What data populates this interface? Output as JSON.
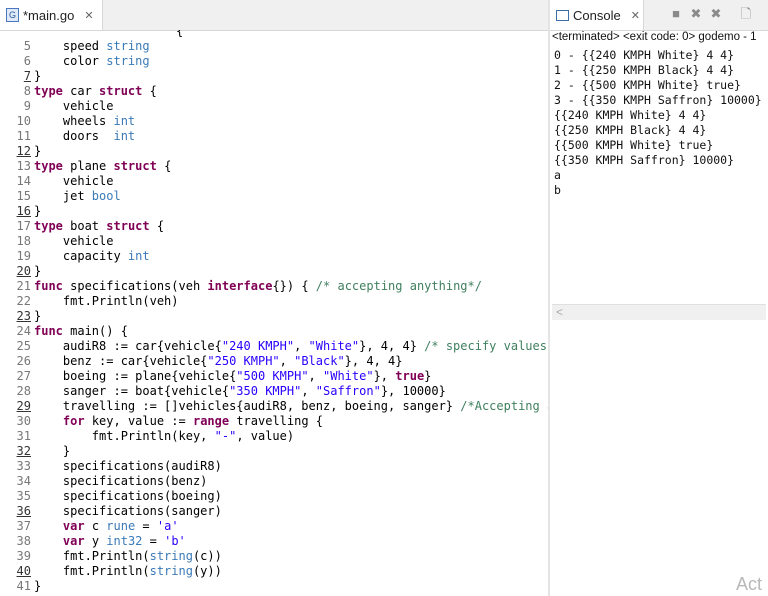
{
  "editor": {
    "tab": {
      "icon": "go-file-icon",
      "icon_glyph": "G",
      "title": "*main.go",
      "close": "✕"
    }
  },
  "code_lines": [
    {
      "n": "",
      "partial": true,
      "segs": [
        [
          "",
          "~"
        ]
      ]
    },
    {
      "n": "5",
      "segs": [
        [
          "",
          "    speed "
        ],
        [
          "ty",
          "string"
        ]
      ]
    },
    {
      "n": "6",
      "segs": [
        [
          "",
          "    color "
        ],
        [
          "ty",
          "string"
        ]
      ]
    },
    {
      "n": "7",
      "u": true,
      "segs": [
        [
          "",
          "}"
        ]
      ]
    },
    {
      "n": "8",
      "segs": [
        [
          "kw",
          "type"
        ],
        [
          "",
          " car "
        ],
        [
          "kw",
          "struct"
        ],
        [
          "",
          " {"
        ]
      ]
    },
    {
      "n": "9",
      "segs": [
        [
          "",
          "    vehicle"
        ]
      ]
    },
    {
      "n": "10",
      "segs": [
        [
          "",
          "    wheels "
        ],
        [
          "ty",
          "int"
        ]
      ]
    },
    {
      "n": "11",
      "segs": [
        [
          "",
          "    doors  "
        ],
        [
          "ty",
          "int"
        ]
      ]
    },
    {
      "n": "12",
      "u": true,
      "segs": [
        [
          "",
          "}"
        ]
      ]
    },
    {
      "n": "13",
      "segs": [
        [
          "kw",
          "type"
        ],
        [
          "",
          " plane "
        ],
        [
          "kw",
          "struct"
        ],
        [
          "",
          " {"
        ]
      ]
    },
    {
      "n": "14",
      "segs": [
        [
          "",
          "    vehicle"
        ]
      ]
    },
    {
      "n": "15",
      "segs": [
        [
          "",
          "    jet "
        ],
        [
          "ty",
          "bool"
        ]
      ]
    },
    {
      "n": "16",
      "u": true,
      "segs": [
        [
          "",
          "}"
        ]
      ]
    },
    {
      "n": "17",
      "segs": [
        [
          "kw",
          "type"
        ],
        [
          "",
          " boat "
        ],
        [
          "kw",
          "struct"
        ],
        [
          "",
          " {"
        ]
      ]
    },
    {
      "n": "18",
      "segs": [
        [
          "",
          "    vehicle"
        ]
      ]
    },
    {
      "n": "19",
      "segs": [
        [
          "",
          "    capacity "
        ],
        [
          "ty",
          "int"
        ]
      ]
    },
    {
      "n": "20",
      "u": true,
      "segs": [
        [
          "",
          "}"
        ]
      ]
    },
    {
      "n": "21",
      "segs": [
        [
          "kw",
          "func"
        ],
        [
          "",
          " specifications(veh "
        ],
        [
          "kw",
          "interface"
        ],
        [
          "",
          "{}) { "
        ],
        [
          "cm",
          "/* accepting anything*/"
        ]
      ]
    },
    {
      "n": "22",
      "segs": [
        [
          "",
          "    fmt.Println(veh)"
        ]
      ]
    },
    {
      "n": "23",
      "u": true,
      "segs": [
        [
          "",
          "}"
        ]
      ]
    },
    {
      "n": "24",
      "segs": [
        [
          "kw",
          "func"
        ],
        [
          "",
          " main() {"
        ]
      ]
    },
    {
      "n": "25",
      "segs": [
        [
          "",
          "    audiR8 := car{vehicle{"
        ],
        [
          "str",
          "\"240 KMPH\""
        ],
        [
          "",
          ", "
        ],
        [
          "str",
          "\"White\""
        ],
        [
          "",
          "}, 4, 4} "
        ],
        [
          "cm",
          "/* specify values*/"
        ]
      ]
    },
    {
      "n": "26",
      "segs": [
        [
          "",
          "    benz := car{vehicle{"
        ],
        [
          "str",
          "\"250 KMPH\""
        ],
        [
          "",
          ", "
        ],
        [
          "str",
          "\"Black\""
        ],
        [
          "",
          "}, 4, 4}"
        ]
      ]
    },
    {
      "n": "27",
      "segs": [
        [
          "",
          "    boeing := plane{vehicle{"
        ],
        [
          "str",
          "\"500 KMPH\""
        ],
        [
          "",
          ", "
        ],
        [
          "str",
          "\"White\""
        ],
        [
          "",
          "}, "
        ],
        [
          "kw",
          "true"
        ],
        [
          "",
          "}"
        ]
      ]
    },
    {
      "n": "28",
      "segs": [
        [
          "",
          "    sanger := boat{vehicle{"
        ],
        [
          "str",
          "\"350 KMPH\""
        ],
        [
          "",
          ", "
        ],
        [
          "str",
          "\"Saffron\""
        ],
        [
          "",
          "}, 10000}"
        ]
      ]
    },
    {
      "n": "29",
      "u": true,
      "segs": [
        [
          "",
          "    travelling := []vehicles{audiR8, benz, boeing, sanger} "
        ],
        [
          "cm",
          "/*Accepting any instance*/"
        ]
      ]
    },
    {
      "n": "30",
      "segs": [
        [
          "",
          "    "
        ],
        [
          "kw",
          "for"
        ],
        [
          "",
          " key, value := "
        ],
        [
          "kw",
          "range"
        ],
        [
          "",
          " travelling {"
        ]
      ]
    },
    {
      "n": "31",
      "segs": [
        [
          "",
          "        fmt.Println(key, "
        ],
        [
          "str",
          "\"-\""
        ],
        [
          "",
          ", value)"
        ]
      ]
    },
    {
      "n": "32",
      "u": true,
      "segs": [
        [
          "",
          "    }"
        ]
      ]
    },
    {
      "n": "33",
      "segs": [
        [
          "",
          "    specifications(audiR8)"
        ]
      ]
    },
    {
      "n": "34",
      "segs": [
        [
          "",
          "    specifications(benz)"
        ]
      ]
    },
    {
      "n": "35",
      "segs": [
        [
          "",
          "    specifications(boeing)"
        ]
      ]
    },
    {
      "n": "36",
      "u": true,
      "segs": [
        [
          "",
          "    specifications(sanger)"
        ]
      ]
    },
    {
      "n": "37",
      "segs": [
        [
          "",
          "    "
        ],
        [
          "kw",
          "var"
        ],
        [
          "",
          " c "
        ],
        [
          "ty",
          "rune"
        ],
        [
          "",
          " = "
        ],
        [
          "str",
          "'a'"
        ]
      ]
    },
    {
      "n": "38",
      "segs": [
        [
          "",
          "    "
        ],
        [
          "kw",
          "var"
        ],
        [
          "",
          " y "
        ],
        [
          "ty",
          "int32"
        ],
        [
          "",
          " = "
        ],
        [
          "str",
          "'b'"
        ]
      ]
    },
    {
      "n": "39",
      "segs": [
        [
          "",
          "    fmt.Println("
        ],
        [
          "ty",
          "string"
        ],
        [
          "",
          "(c))"
        ]
      ]
    },
    {
      "n": "40",
      "u": true,
      "segs": [
        [
          "",
          "    fmt.Println("
        ],
        [
          "ty",
          "string"
        ],
        [
          "",
          "(y))"
        ]
      ]
    },
    {
      "n": "41",
      "segs": [
        [
          "",
          "}"
        ]
      ]
    },
    {
      "n": "42",
      "partial": true,
      "segs": [
        [
          "",
          ""
        ]
      ]
    }
  ],
  "console": {
    "tab_title": "Console",
    "tab_close": "✕",
    "toolbar": [
      {
        "icon": "stop-icon",
        "glyph": "■"
      },
      {
        "icon": "remove-launch-icon",
        "glyph": "✖"
      },
      {
        "icon": "remove-all-terminated-icon",
        "glyph": "✖"
      },
      {
        "icon": "clear-console-icon",
        "glyph": "🗋"
      }
    ],
    "status": "<terminated> <exit code: 0> godemo - 1",
    "output": [
      "0 - {{240 KMPH White} 4 4}",
      "1 - {{250 KMPH Black} 4 4}",
      "2 - {{500 KMPH White} true}",
      "3 - {{350 KMPH Saffron} 10000}",
      "{{240 KMPH White} 4 4}",
      "{{250 KMPH Black} 4 4}",
      "{{500 KMPH White} true}",
      "{{350 KMPH Saffron} 10000}",
      "a",
      "b"
    ],
    "scroll_left": "<"
  },
  "watermark": "Act"
}
